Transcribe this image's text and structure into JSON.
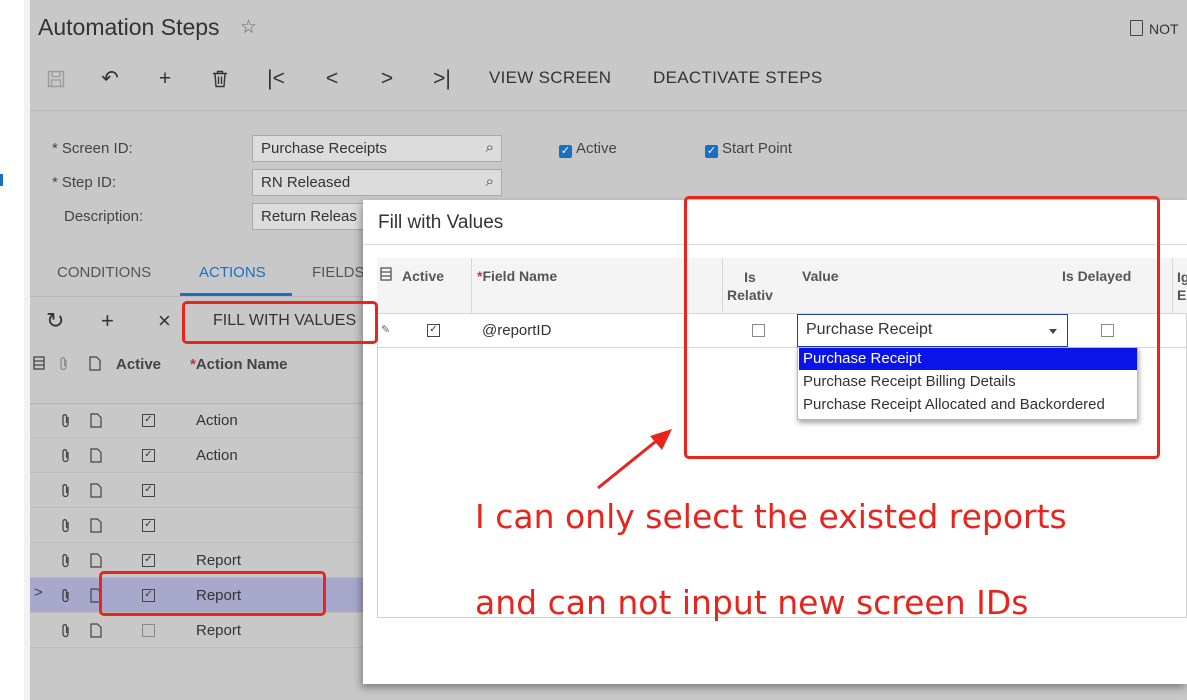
{
  "window": {
    "title": "Automation Steps",
    "favorite_icon": "star-outline-icon",
    "notes_label": "NOT"
  },
  "toolbar": {
    "icons": [
      "save-icon",
      "undo-icon",
      "add-icon",
      "delete-icon",
      "first-record-icon",
      "previous-icon",
      "next-icon",
      "last-record-icon"
    ],
    "view_screen": "VIEW SCREEN",
    "deactivate_steps": "DEACTIVATE STEPS"
  },
  "form": {
    "screen_id_label": "Screen ID:",
    "screen_id_value": "Purchase Receipts",
    "step_id_label": "Step ID:",
    "step_id_value": "RN Released",
    "description_label": "Description:",
    "description_value": "Return Releas",
    "required_marker": "*",
    "active_label": "Active",
    "active_checked": true,
    "start_point_label": "Start Point",
    "start_point_checked": true
  },
  "tabs": [
    {
      "label": "CONDITIONS",
      "active": false
    },
    {
      "label": "ACTIONS",
      "active": true
    },
    {
      "label": "FIELDS",
      "active": false
    }
  ],
  "actions_toolbar": {
    "refresh_icon": "refresh-icon",
    "add_icon": "add-icon",
    "delete_icon": "close-icon",
    "fill_with_values": "FILL WITH VALUES"
  },
  "actions_grid": {
    "columns": [
      "Active",
      "Action Name"
    ],
    "required_marker": "*",
    "rows": [
      {
        "active": true,
        "name": "Action",
        "selected": false
      },
      {
        "active": true,
        "name": "Action",
        "selected": false
      },
      {
        "active": true,
        "name": "",
        "selected": false
      },
      {
        "active": true,
        "name": "",
        "selected": false
      },
      {
        "active": true,
        "name": "Report",
        "selected": false
      },
      {
        "active": true,
        "name": "Report",
        "selected": true
      },
      {
        "active": false,
        "name": "Report",
        "selected": false
      }
    ]
  },
  "dialog": {
    "title": "Fill with Values",
    "columns": {
      "active": "Active",
      "field_name": "Field Name",
      "is_relative": "Is Relativ",
      "is_relative_l1": "Is",
      "is_relative_l2": "Relativ",
      "value": "Value",
      "is_delayed": "Is Delayed",
      "ignore_l1": "Ig",
      "ignore_l2": "E"
    },
    "row": {
      "active": true,
      "field_name": "@reportID",
      "is_relative": false,
      "value": "Purchase Receipt",
      "is_delayed": false
    },
    "dropdown_options": [
      {
        "label": "Purchase Receipt",
        "highlighted": true
      },
      {
        "label": "Purchase Receipt Billing Details",
        "highlighted": false
      },
      {
        "label": "Purchase Receipt Allocated and Backordered",
        "highlighted": false
      }
    ]
  },
  "annotation": {
    "line1": "I can only select the existed reports",
    "line2": "and can not input new screen IDs",
    "color": "#e8251d"
  },
  "colors": {
    "accent": "#1a6fc2",
    "selected_row": "#a8a7cc",
    "dropdown_highlight": "#0a14e6",
    "overlay_gray": "#c8c8c8"
  }
}
